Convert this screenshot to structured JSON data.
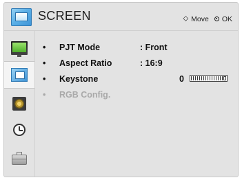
{
  "header": {
    "title": "SCREEN",
    "move_glyph": "⬦",
    "move_label": "Move",
    "ok_label": "OK"
  },
  "sidebar": {
    "items": [
      {
        "icon": "picture-icon",
        "active": false
      },
      {
        "icon": "screen-icon",
        "active": true
      },
      {
        "icon": "audio-icon",
        "active": false
      },
      {
        "icon": "clock-icon",
        "active": false
      },
      {
        "icon": "option-icon",
        "active": false
      }
    ]
  },
  "menu": {
    "bullet": "•",
    "items": [
      {
        "label": "PJT Mode",
        "value": ": Front",
        "enabled": true
      },
      {
        "label": "Aspect Ratio",
        "value": ": 16:9",
        "enabled": true
      },
      {
        "label": "Keystone",
        "value": "0",
        "slider_level": 0,
        "enabled": true
      },
      {
        "label": "RGB Config.",
        "value": "",
        "enabled": false
      }
    ]
  }
}
